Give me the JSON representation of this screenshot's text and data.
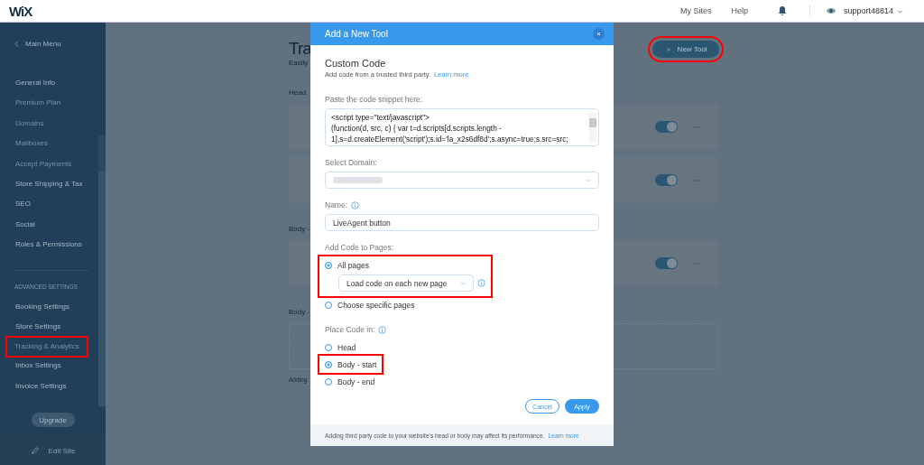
{
  "topbar": {
    "logo": "WiX",
    "links": [
      "My Sites",
      "Help"
    ],
    "user": "support48814"
  },
  "sidebar": {
    "back": "Main Menu",
    "items": [
      {
        "label": "General Info",
        "disabled": false,
        "highlighted": false
      },
      {
        "label": "Premium Plan",
        "disabled": true,
        "highlighted": false
      },
      {
        "label": "Domains",
        "disabled": true,
        "highlighted": false
      },
      {
        "label": "Mailboxes",
        "disabled": true,
        "highlighted": false
      },
      {
        "label": "Accept Payments",
        "disabled": true,
        "highlighted": false
      },
      {
        "label": "Store Shipping & Tax",
        "disabled": false,
        "highlighted": false
      },
      {
        "label": "SEO",
        "disabled": false,
        "highlighted": false
      },
      {
        "label": "Social",
        "disabled": false,
        "highlighted": false
      },
      {
        "label": "Roles & Permissions",
        "disabled": false,
        "highlighted": false
      }
    ],
    "section": "ADVANCED SETTINGS",
    "advanced": [
      {
        "label": "Booking Settings",
        "disabled": false,
        "highlighted": false
      },
      {
        "label": "Store Settings",
        "disabled": false,
        "highlighted": false
      },
      {
        "label": "Tracking & Analytics",
        "disabled": true,
        "highlighted": true
      },
      {
        "label": "Inbox Settings",
        "disabled": false,
        "highlighted": false
      },
      {
        "label": "Invoice Settings",
        "disabled": false,
        "highlighted": false
      }
    ],
    "upgrade": "Upgrade",
    "edit_site": "Edit Site"
  },
  "main": {
    "title": "Tra",
    "subtitle": "Easily",
    "new_tool": {
      "label": "New Tool",
      "highlighted": true
    },
    "sections": [
      {
        "heading": "Head",
        "cards": [
          {
            "on": true
          },
          {
            "on": true
          }
        ]
      },
      {
        "heading": "Body -",
        "cards": [
          {
            "on": true
          }
        ]
      },
      {
        "heading": "Body -"
      }
    ],
    "footer": "Adding"
  },
  "modal": {
    "title": "Add a New Tool",
    "heading": "Custom Code",
    "intro": "Add code from a trusted third party.",
    "intro_link": "Learn more",
    "code_label": "Paste the code snippet here:",
    "code": "<script type=\"text/javascript\">\n(function(d, src, c) { var t=d.scripts[d.scripts.length -\n1],s=d.createElement('script');s.id='la_x2s6df8d';s.async=true;s.src=src;",
    "domain_label": "Select Domain:",
    "name_label": "Name:",
    "name_value": "LiveAgent button",
    "pages_label": "Add Code to Pages:",
    "pages": [
      {
        "label": "All pages",
        "selected": true,
        "highlighted": true,
        "dropdown": "Load code on each new page"
      },
      {
        "label": "Choose specific pages",
        "selected": false,
        "highlighted": false
      }
    ],
    "place_label": "Place Code in:",
    "place": [
      {
        "label": "Head",
        "selected": false,
        "highlighted": false
      },
      {
        "label": "Body - start",
        "selected": true,
        "highlighted": true
      },
      {
        "label": "Body - end",
        "selected": false,
        "highlighted": false
      }
    ],
    "cancel": "Cancel",
    "apply": "Apply",
    "footer": "Adding third party code to your website's head or body may affect its performance.",
    "footer_link": "Learn more"
  }
}
